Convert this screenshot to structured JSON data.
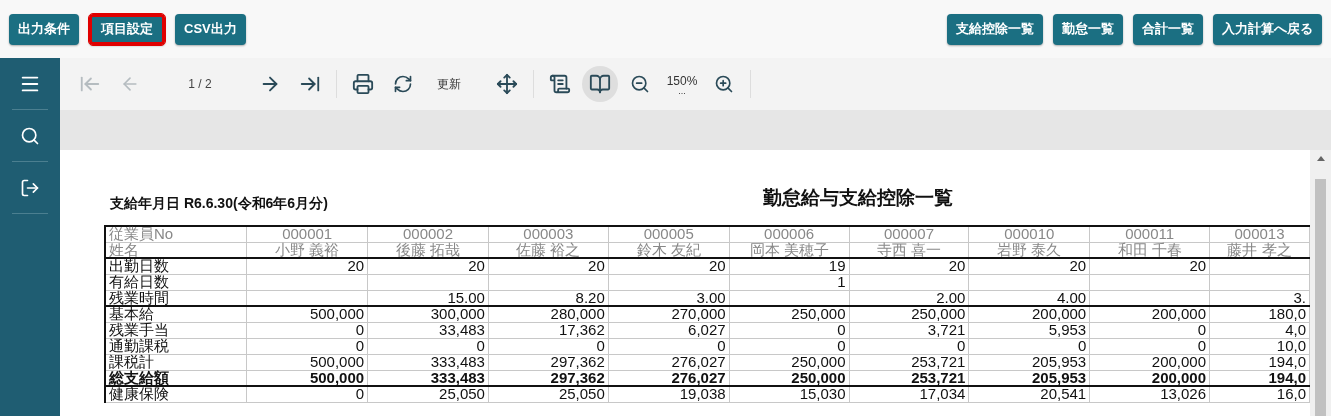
{
  "top_buttons_left": [
    {
      "label": "出力条件",
      "selected": false
    },
    {
      "label": "項目設定",
      "selected": true
    },
    {
      "label": "CSV出力",
      "selected": false
    }
  ],
  "top_buttons_right": [
    {
      "label": "支給控除一覧",
      "selected": false
    },
    {
      "label": "勤怠一覧",
      "selected": false
    },
    {
      "label": "合計一覧",
      "selected": false
    },
    {
      "label": "入力計算へ戻る",
      "selected": false
    }
  ],
  "toolbar": {
    "first_disabled": true,
    "prev_disabled": true,
    "page_indicator": "1 / 2",
    "refresh_label": "更新",
    "book_view_selected": true,
    "zoom": "150%",
    "zoom_more": "..."
  },
  "report": {
    "pay_date": "支給年月日 R6.6.30(令和6年6月分)",
    "title": "勤怠給与支給控除一覧",
    "header_rows": [
      {
        "label": "従業員No",
        "values": [
          "000001",
          "000002",
          "000003",
          "000005",
          "000006",
          "000007",
          "000010",
          "000011",
          "000013"
        ]
      },
      {
        "label": "姓名",
        "values": [
          "小野 義裕",
          "後藤 拓哉",
          "佐藤 裕之",
          "鈴木 友紀",
          "岡本 美穂子",
          "寺西 喜一",
          "岩野 泰久",
          "和田 千春",
          "藤井 孝之"
        ]
      }
    ],
    "rows": [
      {
        "label": "出勤日数",
        "bold": false,
        "group_end": false,
        "values": {
          "c1": "20",
          "c2": "20",
          "c3": "20",
          "c4": "20",
          "c5": "19",
          "c6": "20",
          "c7": "20",
          "c8": "20"
        }
      },
      {
        "label": "有給日数",
        "bold": false,
        "group_end": false,
        "values": {
          "c5": "1"
        }
      },
      {
        "label": "残業時間",
        "bold": false,
        "group_end": true,
        "values": {
          "c2": "15.00",
          "c3": "8.20",
          "c4": "3.00",
          "c6": "2.00",
          "c7": "4.00",
          "c9": "3."
        }
      },
      {
        "label": "基本給",
        "bold": false,
        "group_end": false,
        "values": {
          "c1": "500,000",
          "c2": "300,000",
          "c3": "280,000",
          "c4": "270,000",
          "c5": "250,000",
          "c6": "250,000",
          "c7": "200,000",
          "c8": "200,000",
          "c9": "180,0"
        }
      },
      {
        "label": "残業手当",
        "bold": false,
        "group_end": false,
        "values": {
          "c1": "0",
          "c2": "33,483",
          "c3": "17,362",
          "c4": "6,027",
          "c5": "0",
          "c6": "3,721",
          "c7": "5,953",
          "c8": "0",
          "c9": "4,0"
        }
      },
      {
        "label": "通勤課税",
        "bold": false,
        "group_end": false,
        "values": {
          "c1": "0",
          "c2": "0",
          "c3": "0",
          "c4": "0",
          "c5": "0",
          "c6": "0",
          "c7": "0",
          "c8": "0",
          "c9": "10,0"
        }
      },
      {
        "label": "課税計",
        "bold": false,
        "group_end": false,
        "values": {
          "c1": "500,000",
          "c2": "333,483",
          "c3": "297,362",
          "c4": "276,027",
          "c5": "250,000",
          "c6": "253,721",
          "c7": "205,953",
          "c8": "200,000",
          "c9": "194,0"
        }
      },
      {
        "label": "総支給額",
        "bold": true,
        "group_end": true,
        "values": {
          "c1": "500,000",
          "c2": "333,483",
          "c3": "297,362",
          "c4": "276,027",
          "c5": "250,000",
          "c6": "253,721",
          "c7": "205,953",
          "c8": "200,000",
          "c9": "194,0"
        }
      },
      {
        "label": "健康保険",
        "bold": false,
        "group_end": false,
        "values": {
          "c1": "0",
          "c2": "25,050",
          "c3": "25,050",
          "c4": "19,038",
          "c5": "15,030",
          "c6": "17,034",
          "c7": "20,541",
          "c8": "13,026",
          "c9": "16,0"
        }
      }
    ]
  }
}
